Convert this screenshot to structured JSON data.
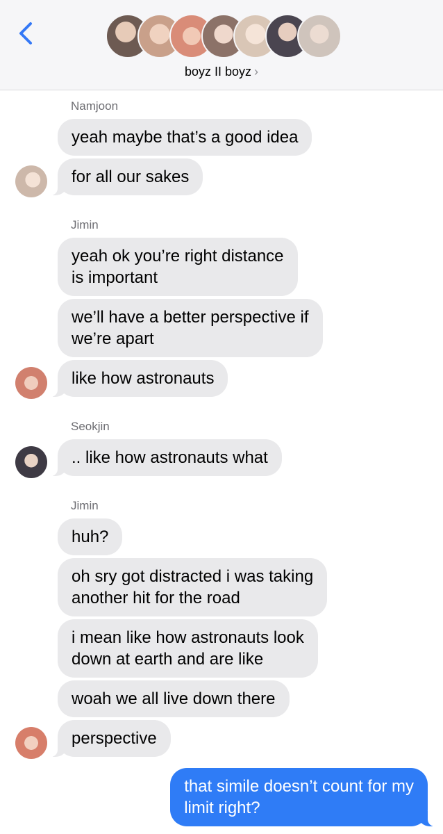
{
  "header": {
    "group_name": "boyz II boyz",
    "chevron": "›",
    "back_icon": "chevron-left-icon",
    "member_avatar_colors": [
      "#6d5a52",
      "#c9a08a",
      "#d98c78",
      "#8c7268",
      "#d9c6b6",
      "#4a4550",
      "#cfc4bc"
    ]
  },
  "messages": [
    {
      "sender": "Namjoon",
      "text": "yeah maybe that’s a good idea"
    },
    {
      "text": "for all our sakes"
    },
    {
      "sender": "Jimin",
      "text": "yeah ok you’re right distance\nis important"
    },
    {
      "text": "we’ll have a better perspective if\nwe’re apart"
    },
    {
      "text": "like how astronauts"
    },
    {
      "sender": "Seokjin",
      "text": ".. like how astronauts what"
    },
    {
      "sender": "Jimin",
      "text": "huh?"
    },
    {
      "text": "oh sry got distracted i was taking\nanother hit for the road"
    },
    {
      "text": "i mean like how astronauts look\ndown at earth and are like"
    },
    {
      "text": "woah we all live down there"
    },
    {
      "text": "perspective"
    },
    {
      "text": "that simile doesn’t count for my\nlimit right?"
    }
  ],
  "colors": {
    "incoming_bubble": "#e9e9eb",
    "outgoing_bubble": "#2f7cf6",
    "accent": "#3478f6"
  }
}
